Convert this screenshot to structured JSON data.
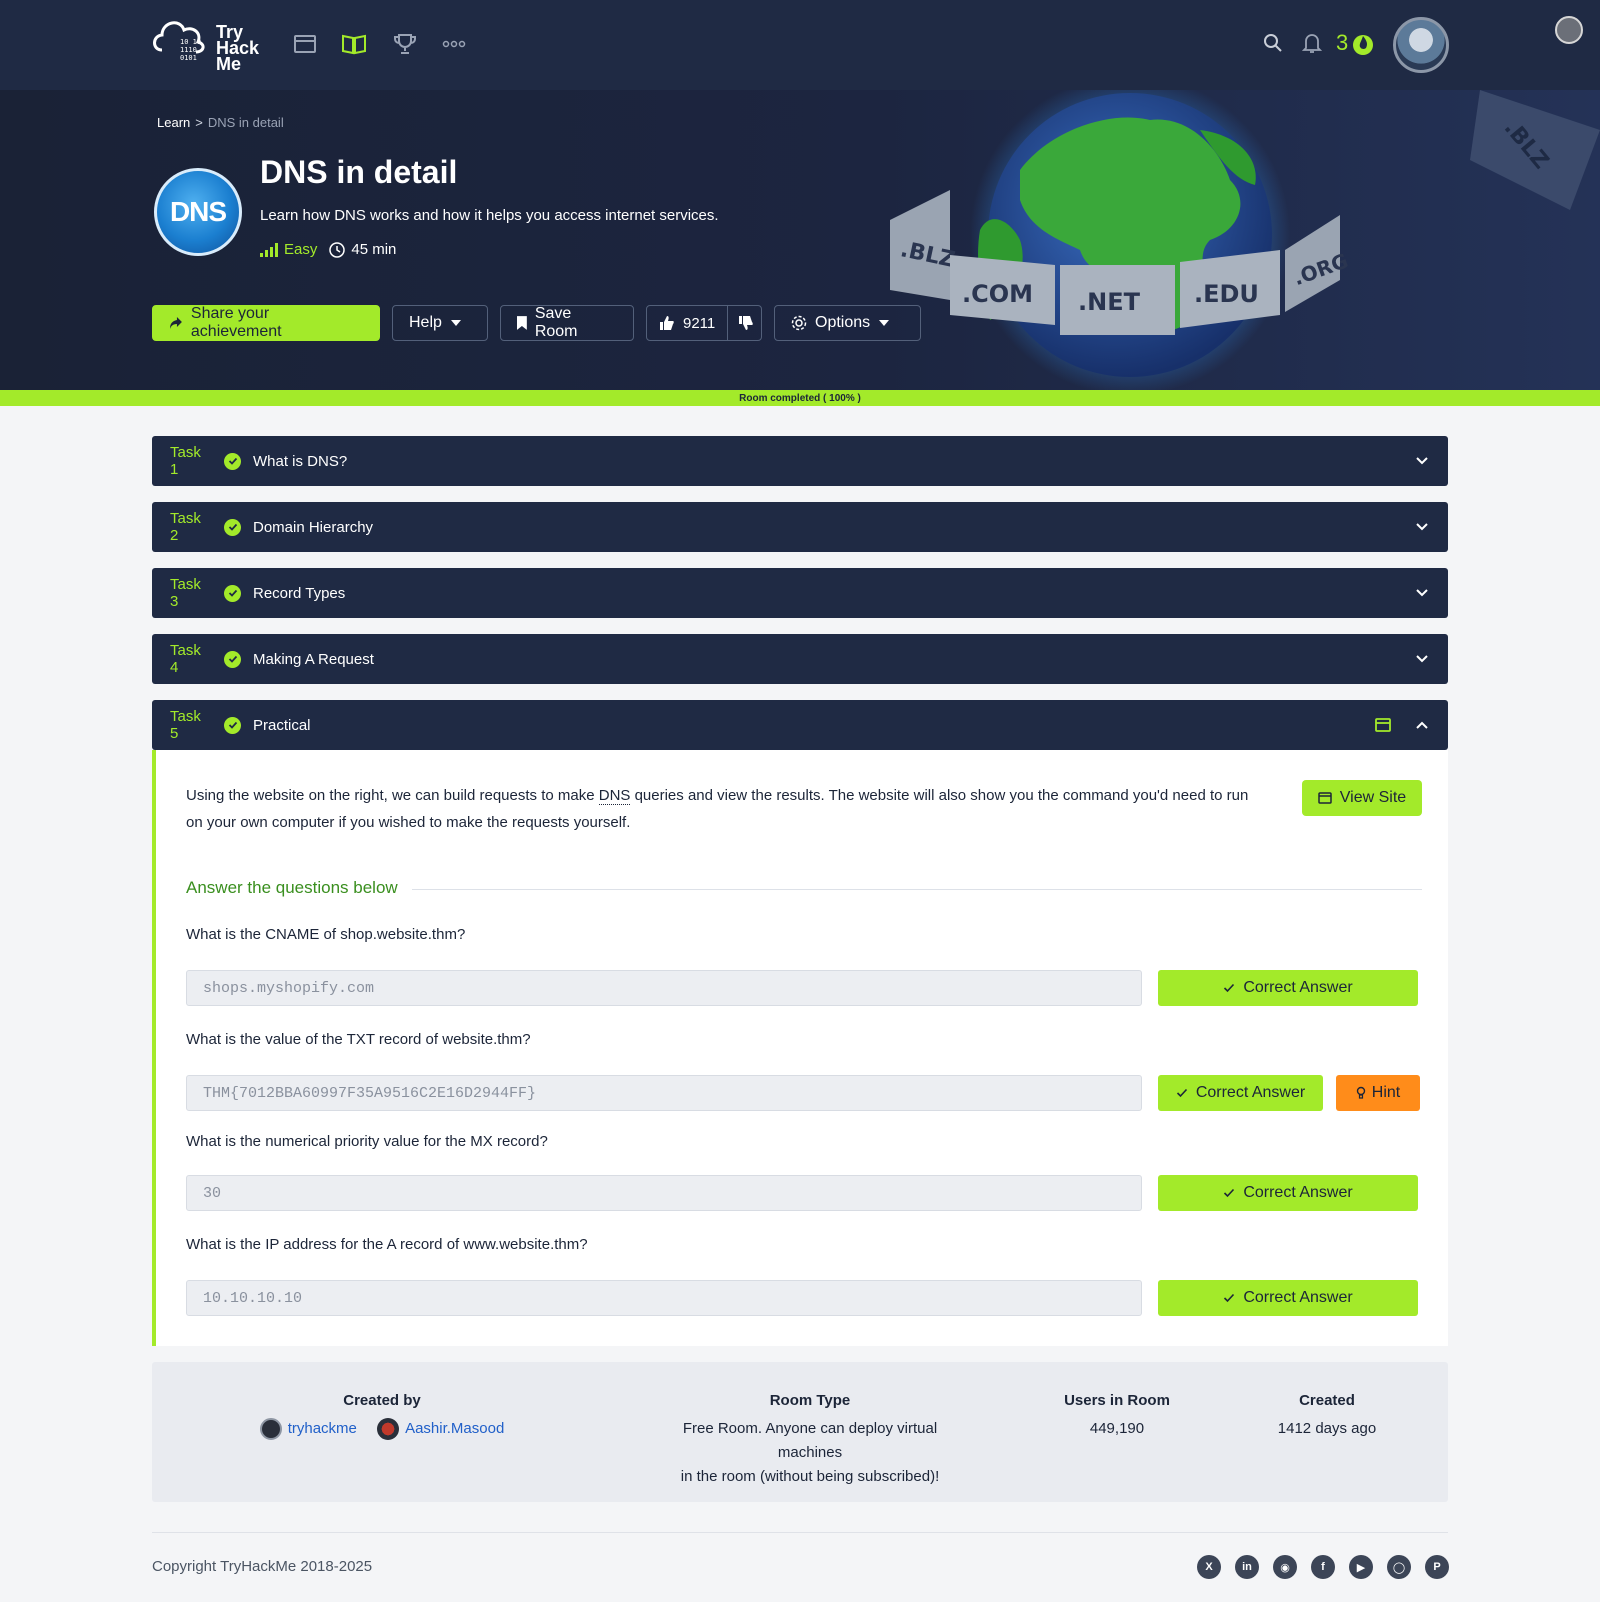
{
  "brand": {
    "logo_name": "TryHackMe",
    "logo_lines": [
      "Try",
      "Hack",
      "Me"
    ]
  },
  "nav": {
    "icons": [
      "dashboard-icon",
      "learn-book-icon",
      "trophy-icon",
      "more-dots-icon"
    ],
    "streak_count": "3"
  },
  "breadcrumb": {
    "root": "Learn",
    "separator": ">",
    "current": "DNS in detail"
  },
  "room": {
    "icon_text": "DNS",
    "title": "DNS in detail",
    "description": "Learn how DNS works and how it helps you access internet services.",
    "difficulty": "Easy",
    "duration": "45 min"
  },
  "actions": {
    "share": "Share your achievement",
    "help": "Help",
    "save": "Save Room",
    "likes": "9211",
    "options": "Options"
  },
  "hero_art": {
    "tlds": [
      ".BLZ",
      ".COM",
      ".NET",
      ".EDU",
      ".ORG",
      ".BLZ"
    ]
  },
  "progress": {
    "label": "Room completed ( 100% )",
    "value": 1.0
  },
  "tasks": [
    {
      "number": "Task 1",
      "title": "What is DNS?"
    },
    {
      "number": "Task 2",
      "title": "Domain Hierarchy"
    },
    {
      "number": "Task 3",
      "title": "Record Types"
    },
    {
      "number": "Task 4",
      "title": "Making A Request"
    },
    {
      "number": "Task 5",
      "title": "Practical"
    }
  ],
  "task5": {
    "text_before": "Using the website on the right, we can build requests to make ",
    "text_abbr": "DNS",
    "text_after": " queries and view the results. The website will also show you the command you'd need to run on your own computer if you wished to make the requests yourself.",
    "view_site": "View Site",
    "answer_heading": "Answer the questions below",
    "questions": [
      {
        "question": "What is the CNAME of shop.website.thm?",
        "answer": "shops.myshopify.com",
        "status": "Correct Answer"
      },
      {
        "question": "What is the value of the TXT record of website.thm?",
        "answer": "THM{7012BBA60997F35A9516C2E16D2944FF}",
        "status": "Correct Answer",
        "hint": "Hint"
      },
      {
        "question": "What is the numerical priority value for the MX record?",
        "answer": "30",
        "status": "Correct Answer"
      },
      {
        "question": "What is the IP address for the A record of www.website.thm?",
        "answer": "10.10.10.10",
        "status": "Correct Answer"
      }
    ]
  },
  "info": {
    "created_by_label": "Created by",
    "creators": [
      "tryhackme",
      "Aashir.Masood"
    ],
    "room_type_label": "Room Type",
    "room_type_value_1": "Free Room. Anyone can deploy virtual machines",
    "room_type_value_2": "in the room (without being subscribed)!",
    "users_label": "Users in Room",
    "users_value": "449,190",
    "created_label": "Created",
    "created_value": "1412 days ago"
  },
  "footer": {
    "copyright": "Copyright TryHackMe 2018-2025",
    "socials": [
      "x-icon",
      "linkedin-icon",
      "discord-icon",
      "facebook-icon",
      "youtube-icon",
      "instagram-icon",
      "pinterest-icon"
    ]
  },
  "colors": {
    "navy": "#1f2a44",
    "accent_green": "#a3ea2a",
    "hint_orange": "#ff8c1a",
    "link_blue": "#2160c9"
  }
}
